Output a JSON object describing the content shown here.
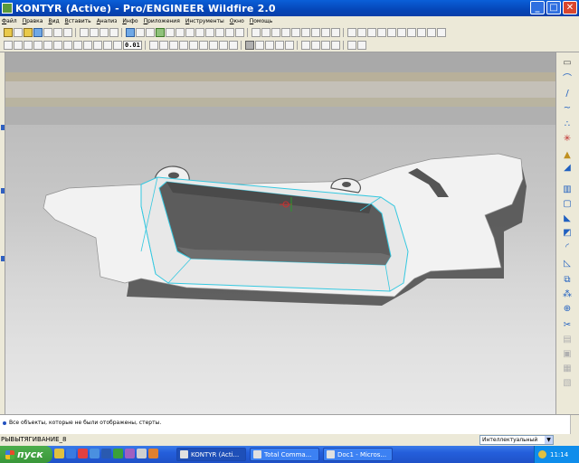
{
  "window": {
    "title": "KONTYR (Active) - Pro/ENGINEER Wildfire 2.0",
    "min_label": "_",
    "max_label": "□",
    "close_label": "✕"
  },
  "menu": {
    "items": [
      "Файл",
      "Правка",
      "Вид",
      "Вставить",
      "Анализ",
      "Инфо",
      "Приложения",
      "Инструменты",
      "Окно",
      "Помощь"
    ]
  },
  "toolbar": {
    "scale_value": "0.01"
  },
  "message_area": {
    "message": "Все объекты, которые не были отображены, стерты."
  },
  "status_bar": {
    "feature_status": "РЫВЫТЯГИВАНИЕ_8",
    "selection_filter": "Интеллектуальный"
  },
  "taskbar": {
    "start_label": "пуск",
    "tasks": [
      "KONTYR (Acti...",
      "Total Comma...",
      "Doc1 - Micros..."
    ],
    "clock": "11:14"
  },
  "colors": {
    "model_fill": "#f2f2f2",
    "model_shadow": "#4a4a4a",
    "cavity_wall": "#5a5a5a",
    "selection_edge": "#35c8e0",
    "title_bar": "#0a5fd8",
    "taskbar": "#245edb"
  }
}
